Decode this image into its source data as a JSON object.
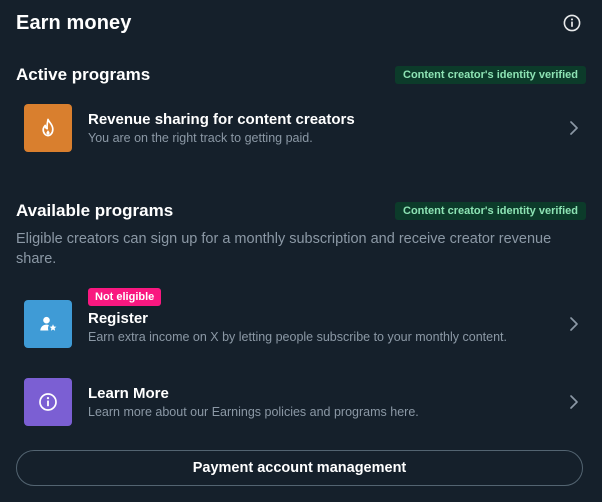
{
  "header": {
    "title": "Earn money",
    "info_icon": "info-circle-icon"
  },
  "active": {
    "title": "Active programs",
    "badge": "Content creator's identity verified",
    "items": [
      {
        "title": "Revenue sharing for content creators",
        "subtitle": "You are on the right track to getting paid.",
        "icon": "flame-icon",
        "icon_color": "#d97f2e"
      }
    ]
  },
  "available": {
    "title": "Available programs",
    "badge": "Content creator's identity verified",
    "description": "Eligible creators can sign up for a monthly subscription and receive creator revenue share.",
    "items": [
      {
        "pill": "Not eligible",
        "title": "Register",
        "subtitle": "Earn extra income on X by letting people subscribe to your monthly content.",
        "icon": "user-star-icon",
        "icon_color": "#3f9bd6"
      },
      {
        "title": "Learn More",
        "subtitle": "Learn more about our Earnings policies and programs here.",
        "icon": "info-circle-icon",
        "icon_color": "#7b5fd3"
      }
    ]
  },
  "footer": {
    "payment_button": "Payment account management"
  },
  "colors": {
    "background": "#15202b",
    "verified_badge_bg": "#0c3b2a",
    "verified_badge_text": "#8de3b4",
    "pill_red": "#f91880",
    "muted_text": "#8b98a5"
  }
}
